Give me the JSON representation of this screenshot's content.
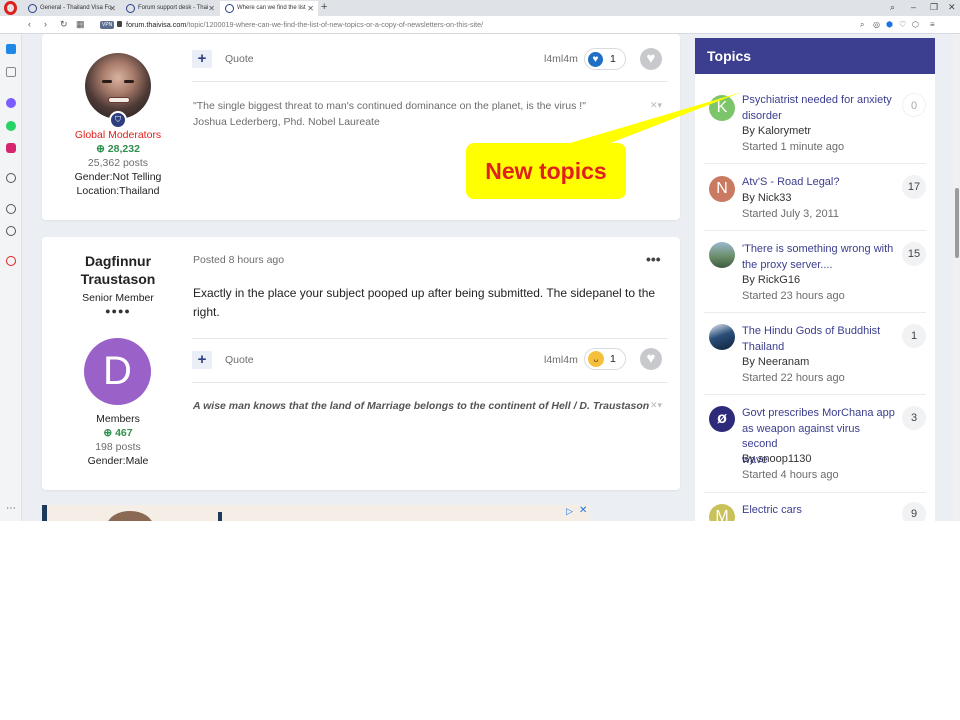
{
  "browser": {
    "tabs": [
      {
        "label": "General - Thailand Visa Fo"
      },
      {
        "label": "Forum support desk - Thai"
      },
      {
        "label": "Where can we find the list"
      }
    ],
    "url_domain": "forum.thaivisa.com",
    "url_path": "/topic/1200019-where-can-we-find-the-list-of-new-topics-or-a-copy-of-newsletters-on-this-site/",
    "vpn_label": "VPN"
  },
  "post1": {
    "author_group": "Global Moderators",
    "reputation": "28,232",
    "post_count": "25,362 posts",
    "gender": "Gender:Not Telling",
    "location": "Location:Thailand",
    "quote_label": "Quote",
    "reactor": "l4ml4m",
    "reaction_count": "1",
    "signature_line1": "\"The single biggest threat to man's continued dominance on the planet, is the virus !\"",
    "signature_line2": "Joshua Lederberg, Phd. Nobel Laureate"
  },
  "post2": {
    "author_first": "Dagfinnur",
    "author_last": "Traustason",
    "author_rank": "Senior Member",
    "avatar_letter": "D",
    "author_group": "Members",
    "reputation": "467",
    "post_count": "198 posts",
    "gender": "Gender:Male",
    "posted_prefix": "Posted",
    "posted_time": "8 hours ago",
    "body_line1": "Exactly in the place your subject pooped up after being submitted. The sidepanel to the",
    "body_line2": "right.",
    "quote_label": "Quote",
    "reactor": "l4ml4m",
    "reaction_count": "1",
    "signature": "A wise man knows that the land of Marriage belongs to the continent of Hell / D. Traustason"
  },
  "annotation": {
    "callout_text": "New topics",
    "color_fill": "#ffff00",
    "color_text": "#e0201b"
  },
  "topics": {
    "header": "Topics",
    "items": [
      {
        "title1": "Psychiatrist needed for anxiety",
        "title2": "disorder",
        "title3": "",
        "by": "By Kalorymetr",
        "started": "Started 1 minute ago",
        "count": "0",
        "avatar_letter": "K",
        "avatar_color": "#7cc56a"
      },
      {
        "title1": "Atv'S - Road Legal?",
        "title2": "",
        "title3": "",
        "by": "By Nick33",
        "started": "Started July 3, 2011",
        "count": "17",
        "avatar_letter": "N",
        "avatar_color": "#c97a60"
      },
      {
        "title1": "'There is something wrong with",
        "title2": "the proxy server....",
        "title3": "",
        "by": "By RickG16",
        "started": "Started 23 hours ago",
        "count": "15",
        "avatar_letter": "",
        "avatar_color": "#6a8f6a"
      },
      {
        "title1": "The Hindu Gods of Buddhist",
        "title2": "Thailand",
        "title3": "",
        "by": "By Neeranam",
        "started": "Started 22 hours ago",
        "count": "1",
        "avatar_letter": "",
        "avatar_color": "#2b4f7a"
      },
      {
        "title1": "Govt prescribes MorChana app",
        "title2": "as weapon against virus second",
        "title3": "wave",
        "by": "By snoop1130",
        "started": "Started 4 hours ago",
        "count": "3",
        "avatar_letter": "ø",
        "avatar_color": "#2d2a7a"
      },
      {
        "title1": "Electric cars",
        "title2": "",
        "title3": "",
        "by": "",
        "started": "",
        "count": "9",
        "avatar_letter": "M",
        "avatar_color": "#c9c25a"
      }
    ]
  },
  "colors": {
    "brand_purple": "#3c3e8f",
    "moderator_red": "#e0201b",
    "reputation_green": "#2f8f4e"
  }
}
